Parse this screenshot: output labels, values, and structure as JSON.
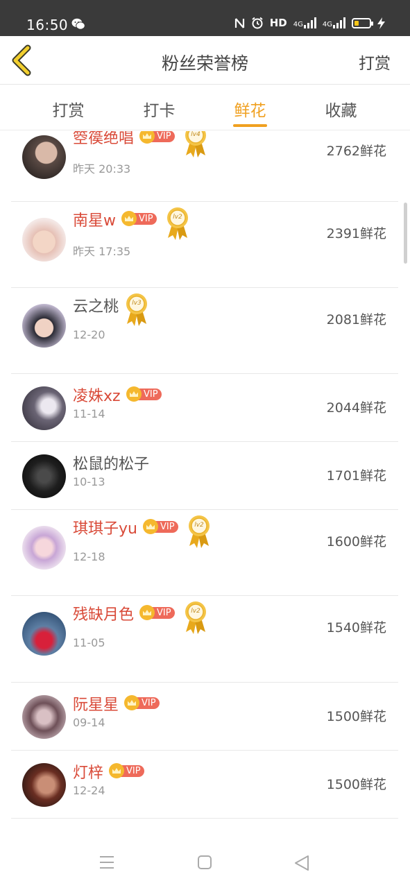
{
  "status_bar": {
    "time": "16:50",
    "network_label": "HD",
    "net_4g_a": "4G",
    "net_4g_b": "4G",
    "icons": [
      "wechat-icon",
      "nfc-icon",
      "alarm-icon",
      "signal-icon",
      "battery-icon",
      "charging-icon"
    ]
  },
  "header": {
    "title": "粉丝荣誉榜",
    "action": "打赏"
  },
  "tabs": [
    {
      "label": "打赏"
    },
    {
      "label": "打卡"
    },
    {
      "label": "鲜花",
      "active": true
    },
    {
      "label": "收藏"
    }
  ],
  "vip_label": "VIP",
  "list": [
    {
      "name": "箜篌绝唱",
      "date": "昨天 20:33",
      "amount": "2762鲜花",
      "vip": true,
      "level": "lv4"
    },
    {
      "name": "南星w",
      "date": "昨天 17:35",
      "amount": "2391鲜花",
      "vip": true,
      "level": "lv2"
    },
    {
      "name": "云之桃",
      "date": "12-20",
      "amount": "2081鲜花",
      "vip": false,
      "level": "lv3"
    },
    {
      "name": "凌姝xz",
      "date": "11-14",
      "amount": "2044鲜花",
      "vip": true,
      "level": ""
    },
    {
      "name": "松鼠的松子",
      "date": "10-13",
      "amount": "1701鲜花",
      "vip": false,
      "level": ""
    },
    {
      "name": "琪琪子yu",
      "date": "12-18",
      "amount": "1600鲜花",
      "vip": true,
      "level": "lv2"
    },
    {
      "name": "残缺月色",
      "date": "11-05",
      "amount": "1540鲜花",
      "vip": true,
      "level": "lv2"
    },
    {
      "name": "阮星星",
      "date": "09-14",
      "amount": "1500鲜花",
      "vip": true,
      "level": ""
    },
    {
      "name": "灯梓",
      "date": "12-24",
      "amount": "1500鲜花",
      "vip": true,
      "level": ""
    }
  ],
  "colors": {
    "accent": "#f0a020",
    "vip_name": "#d94a38",
    "vip_tag": "#ee6a5a",
    "status_bar": "#3a3a3a"
  },
  "battery_level": 0.3
}
